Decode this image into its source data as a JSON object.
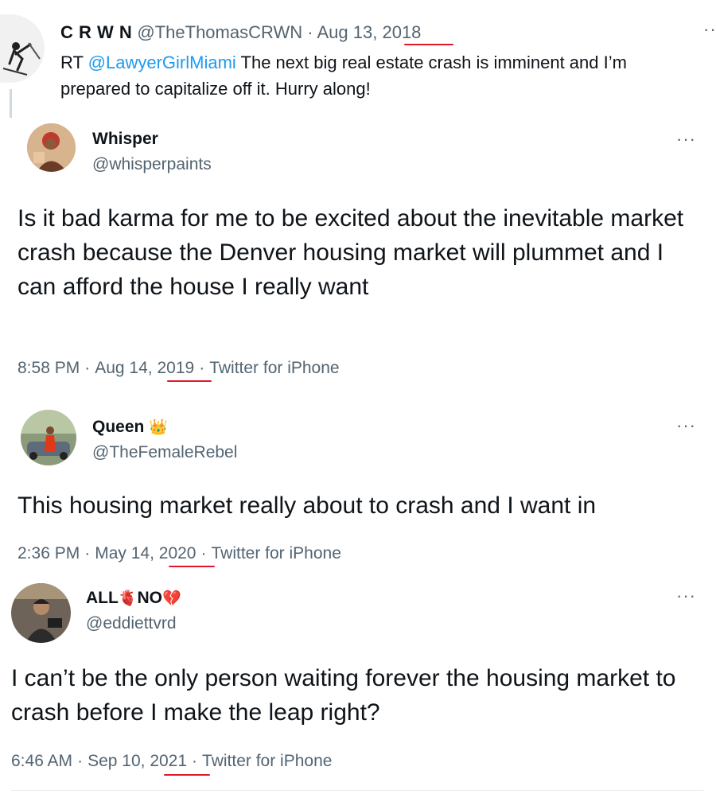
{
  "tweet1": {
    "display_name": "C R W N",
    "handle": "@TheThomasCRWN",
    "separator": "·",
    "date_prefix": "Aug 13,",
    "year": "2018",
    "rt_prefix": "RT",
    "mention": "@LawyerGirlMiami",
    "text_line1": "The next big real estate crash is imminent and I’m",
    "text_line2": "prepared to capitalize off it. Hurry along!",
    "more": "··"
  },
  "tweet2": {
    "display_name": "Whisper",
    "handle": "@whisperpaints",
    "body": "Is it bad karma for me to be excited about the inevitable market crash because the Denver housing market will plummet and I can afford the house I really want",
    "time": "8:58 PM",
    "date_prefix": "Aug 14,",
    "year": "2019",
    "source": "Twitter for iPhone",
    "more": "···"
  },
  "tweet3": {
    "display_name": "Queen",
    "emoji": "👑",
    "handle": "@TheFemaleRebel",
    "body": "This housing market really about to crash and I want in",
    "time": "2:36 PM",
    "date_prefix": "May 14,",
    "year": "2020",
    "source": "Twitter for iPhone",
    "more": "···"
  },
  "tweet4": {
    "name_part1": "ALL",
    "emoji1": "🫀",
    "name_part2": "NO",
    "emoji2": "💔",
    "handle": "@eddiettvrd",
    "body": "I can’t be the only person waiting forever the housing market to crash before I make the leap right?",
    "time": "6:46 AM",
    "date_prefix": "Sep 10,",
    "year": "2021",
    "source": "Twitter for iPhone",
    "more": "···"
  },
  "meta_separator": "·",
  "colors": {
    "text": "#0f1419",
    "muted": "#536471",
    "link": "#1d9bf0",
    "underline": "#e0192a"
  }
}
